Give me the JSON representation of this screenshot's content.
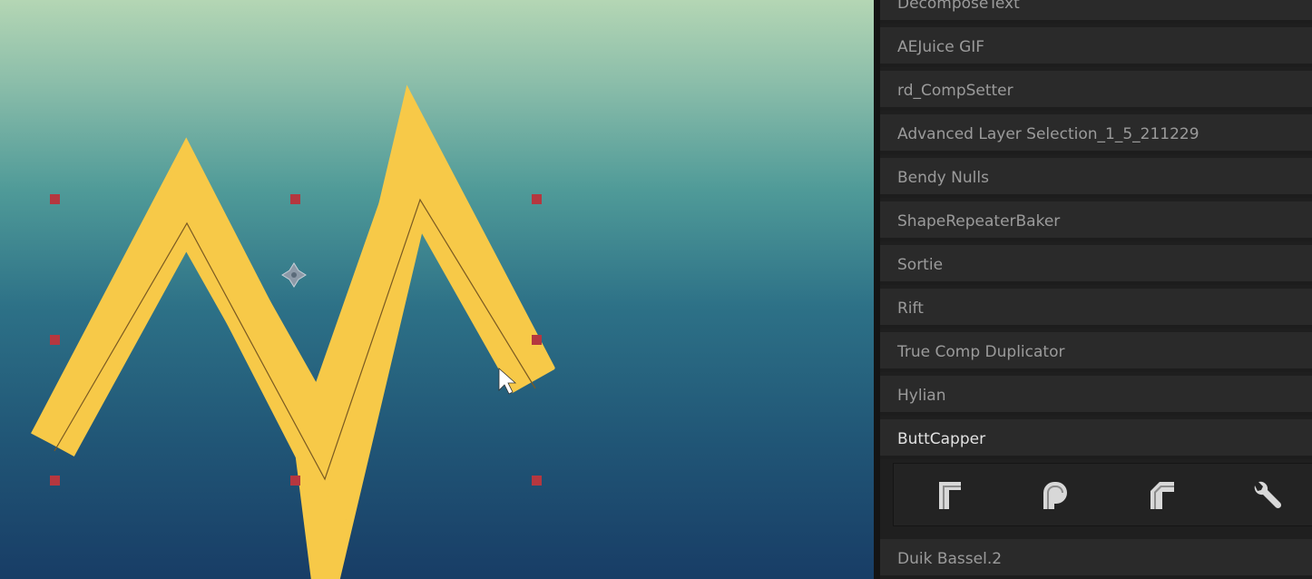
{
  "scripts_panel": {
    "items": [
      {
        "label": "DecomposeText"
      },
      {
        "label": "AEJuice GIF"
      },
      {
        "label": "rd_CompSetter"
      },
      {
        "label": "Advanced Layer Selection_1_5_211229"
      },
      {
        "label": "Bendy Nulls"
      },
      {
        "label": "ShapeRepeaterBaker"
      },
      {
        "label": "Sortie"
      },
      {
        "label": "Rift"
      },
      {
        "label": "True Comp Duplicator"
      },
      {
        "label": "Hylian"
      },
      {
        "label": "ButtCapper"
      }
    ],
    "after_toolbar_item": {
      "label": "Duik Bassel.2"
    },
    "buttcapper_buttons": [
      {
        "icon": "butt-cap-icon"
      },
      {
        "icon": "round-cap-icon"
      },
      {
        "icon": "bevel-cap-icon"
      },
      {
        "icon": "wrench-icon"
      }
    ]
  },
  "viewer": {
    "stroke_color": "#f7c948",
    "handle_color": "#b5373f",
    "background_top": "#b4d6b4",
    "background_bottom": "#183d66"
  }
}
